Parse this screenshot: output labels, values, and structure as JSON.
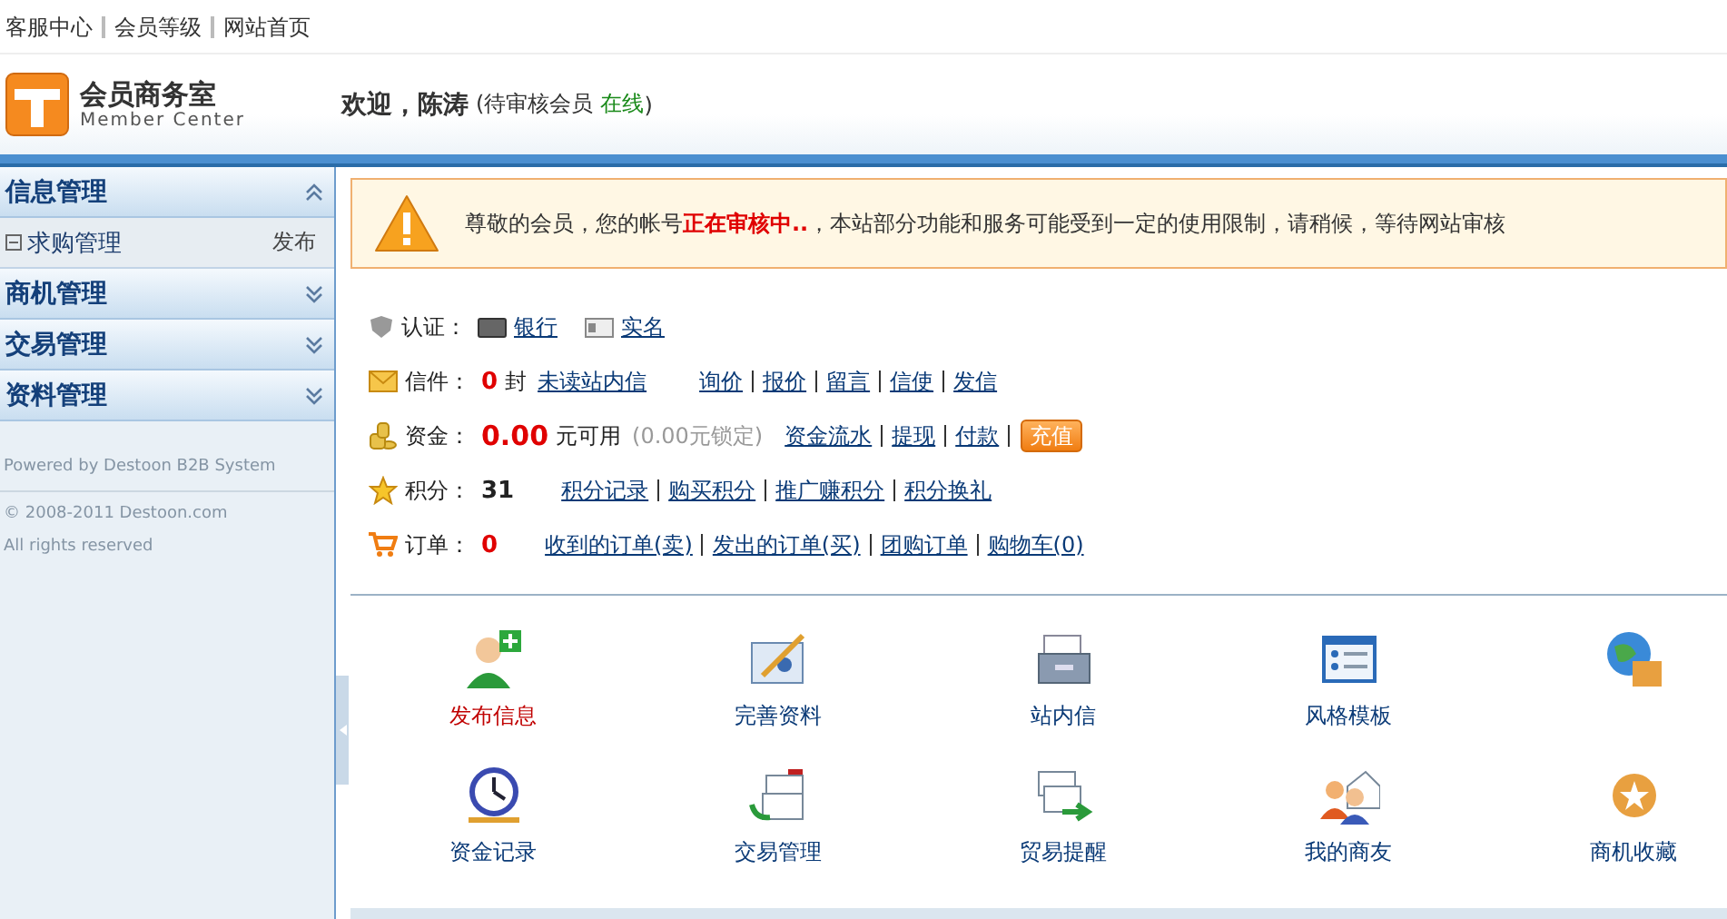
{
  "top_links": [
    {
      "label": "客服中心"
    },
    {
      "label": "会员等级"
    },
    {
      "label": "网站首页"
    }
  ],
  "header": {
    "logo_title": "会员商务室",
    "logo_subtitle": "Member Center",
    "greeting": "欢迎，陈涛",
    "status_open": "(待审核会员",
    "online": "在线",
    "status_close": ")"
  },
  "sidebar": {
    "groups": [
      {
        "title": "信息管理",
        "expanded": true,
        "children": [
          {
            "label": "求购管理",
            "action": "发布"
          }
        ]
      },
      {
        "title": "商机管理",
        "expanded": false
      },
      {
        "title": "交易管理",
        "expanded": false
      },
      {
        "title": "资料管理",
        "expanded": false
      }
    ],
    "footer": [
      "Powered by Destoon B2B System",
      "© 2008-2011 Destoon.com",
      "All rights reserved"
    ]
  },
  "notice": "尊敬的会员，您的帐号**正在审核中..**，本站部分功能和服务可能受到一定的使用限制，请稍候，等待网站审核",
  "rows": [
    {
      "kind": "cert",
      "label": "认证：",
      "links": [
        "银行",
        "实名"
      ]
    },
    {
      "kind": "mail",
      "label": "信件：",
      "value": "0",
      "unit": "封",
      "primary_link": "未读站内信",
      "links": [
        "询价",
        "报价",
        "留言",
        "信使",
        "发信"
      ]
    },
    {
      "kind": "funds",
      "label": "资金：",
      "value": "0.00",
      "unit": "元可用",
      "note": "(0.00元锁定)",
      "links": [
        "资金流水",
        "提现",
        "付款"
      ],
      "button": "充值"
    },
    {
      "kind": "points",
      "label": "积分：",
      "value": "31",
      "links": [
        "积分记录",
        "购买积分",
        "推广赚积分",
        "积分换礼"
      ]
    },
    {
      "kind": "orders",
      "label": "订单：",
      "value": "0",
      "links": [
        "收到的订单(卖)",
        "发出的订单(买)",
        "团购订单",
        "购物车(0)"
      ]
    }
  ],
  "shortcuts": [
    {
      "kind": "labeled",
      "label": "发布信息",
      "highlighted": true
    },
    {
      "kind": "labeled",
      "label": "完善资料",
      "highlighted": false
    },
    {
      "kind": "labeled",
      "label": "站内信",
      "highlighted": false
    },
    {
      "kind": "labeled",
      "label": "风格模板",
      "highlighted": false
    },
    {
      "kind": "icon_only"
    },
    {
      "kind": "labeled",
      "label": "资金记录",
      "highlighted": false
    },
    {
      "kind": "labeled",
      "label": "交易管理",
      "highlighted": false
    },
    {
      "kind": "labeled",
      "label": "贸易提醒",
      "highlighted": false
    },
    {
      "kind": "labeled",
      "label": "我的商友",
      "highlighted": false
    },
    {
      "kind": "labeled",
      "label": "商机收藏",
      "highlighted": false
    }
  ]
}
